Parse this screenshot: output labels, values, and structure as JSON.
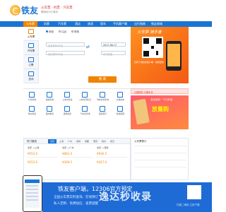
{
  "brand": {
    "name": "铁友",
    "tagline": "火车票 · 机票 · 汽车票",
    "subtitle": "聪明出行小助手"
  },
  "nav": {
    "items": [
      "火车票",
      "机票",
      "汽车票",
      "酒店",
      "旅游",
      "租车",
      "手机客户端",
      "出行指南",
      "铁友商城"
    ],
    "active_index": 0
  },
  "sidebar": {
    "items": [
      {
        "label": "火车票",
        "icon": "train-icon"
      },
      {
        "label": "汽车票",
        "icon": "bus-icon"
      },
      {
        "label": "订票",
        "icon": "ticket-icon"
      },
      {
        "label": "查询",
        "icon": "search-icon"
      }
    ]
  },
  "search": {
    "tabs": [
      "单程",
      "往返",
      "联程"
    ],
    "selected_tab": 0,
    "from_placeholder": "出发城市/车站",
    "to_placeholder": "到达城市/车站",
    "date_value": "2017-08-17",
    "train_type": "车次类型",
    "submit_label": "搜 索"
  },
  "promo": {
    "title": "火车票 随手查",
    "text": "扫码下载铁友客户端 · 抢票更快"
  },
  "grid": {
    "items": [
      "订票查询",
      "快捷查询",
      "火车时刻表",
      "火车票代售点",
      "列车时刻查询",
      "高铁动车",
      "特价机票",
      "国内机票",
      "国际机票",
      "汽车票查询",
      "酒店预订",
      "旅游度假"
    ]
  },
  "ad": {
    "top_text": "分期购机 分期无忧",
    "main_sub": "全民返利 · 千元补贴",
    "main_title": "放量购"
  },
  "hot": {
    "title": "热门路线",
    "tabs": [
      "北京",
      "上海",
      "广州",
      "深圳",
      "成都",
      "南京",
      "杭州",
      "武汉"
    ],
    "selected_tab": 0,
    "cards": [
      {
        "from": "北京 → 上海",
        "price": "¥553.0",
        "price2": "¥253.0"
      },
      {
        "from": "北京 → 广州",
        "price": "¥862.0",
        "price2": "¥309.5"
      },
      {
        "from": "北京 → 深圳",
        "price": "¥936.5",
        "price2": "¥427.0"
      }
    ]
  },
  "train_box": {
    "title": "火车票预订"
  },
  "app_banner": {
    "title": "铁友客户端，12306官方预定",
    "line1": "全国火车票实时查询、在线预订",
    "line2": "私人定制、免费短信、查票提醒",
    "qr_label": "扫描二维码 立即下载"
  },
  "watermark": "逸达秒收录"
}
